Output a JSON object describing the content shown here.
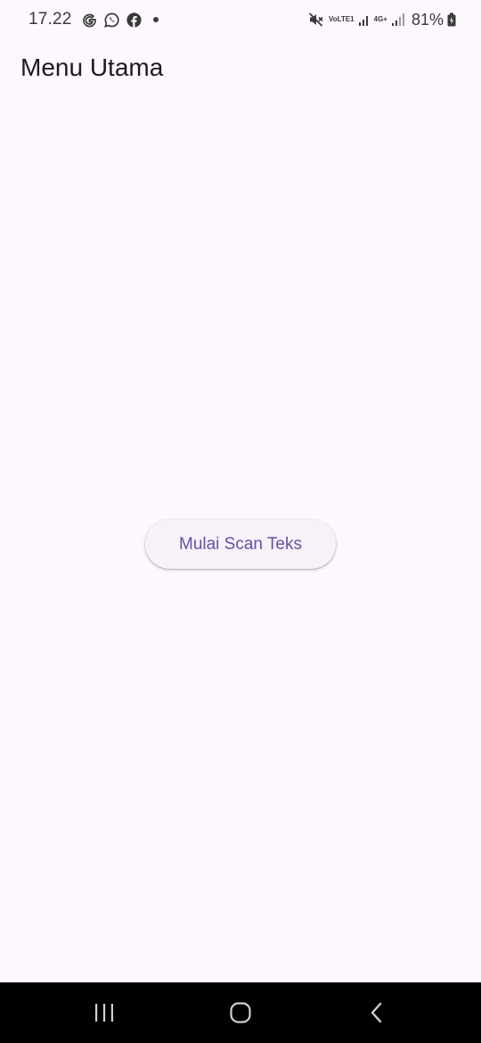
{
  "status_bar": {
    "time": "17.22",
    "notification_icons": [
      "google-icon",
      "whatsapp-icon",
      "facebook-icon"
    ],
    "network_label_1": "VoLTE1",
    "network_label_2": "4G+",
    "battery_percent": "81%"
  },
  "app_bar": {
    "title": "Menu Utama"
  },
  "main": {
    "scan_button_label": "Mulai Scan Teks"
  },
  "nav_bar": {
    "buttons": [
      "recent-apps-icon",
      "home-icon",
      "back-icon"
    ]
  },
  "colors": {
    "background": "#fdf7fe",
    "accent": "#6750a4",
    "button_bg": "#f7f1f9",
    "nav_bg": "#000000"
  }
}
